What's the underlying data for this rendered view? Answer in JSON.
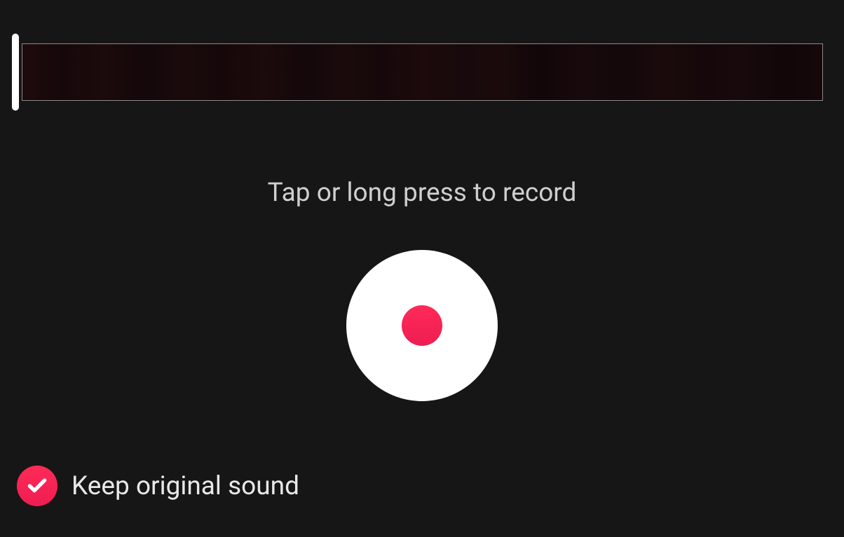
{
  "instruction": "Tap or long press to record",
  "keepOriginalSound": {
    "label": "Keep original sound",
    "checked": true
  },
  "colors": {
    "accent": "#ee1d52",
    "background": "#161616"
  }
}
